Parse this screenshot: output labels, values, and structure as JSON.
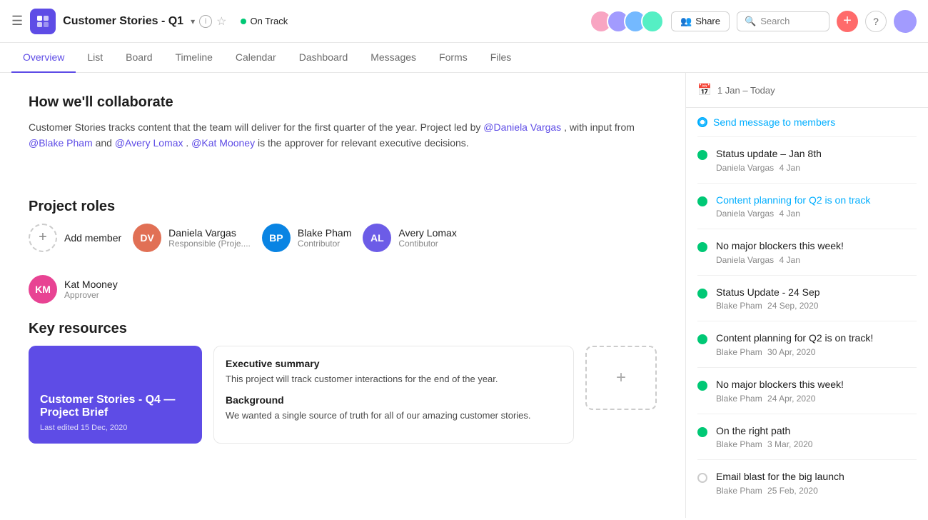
{
  "topbar": {
    "project_title": "Customer Stories - Q1",
    "status_label": "On Track",
    "share_label": "Share",
    "search_placeholder": "Search",
    "add_icon": "+",
    "help_icon": "?"
  },
  "nav": {
    "tabs": [
      "Overview",
      "List",
      "Board",
      "Timeline",
      "Calendar",
      "Dashboard",
      "Messages",
      "Forms",
      "Files"
    ],
    "active": "Overview"
  },
  "overview": {
    "collaborate_title": "How we'll collaborate",
    "collaborate_desc1": "Customer Stories tracks content that the team will deliver for the first quarter of the year. Project led by",
    "mention_daniela": "@Daniela Vargas",
    "collaborate_desc2": ", with input from",
    "mention_blake": "@Blake Pham",
    "collaborate_desc3": "and",
    "mention_avery": "@Avery Lomax",
    "collaborate_desc4": ".",
    "mention_kat": "@Kat Mooney",
    "collaborate_desc5": "is the approver for relevant executive decisions.",
    "roles_title": "Project roles",
    "add_member_label": "Add member",
    "roles": [
      {
        "name": "Daniela Vargas",
        "role": "Responsible (Proje....",
        "initials": "DV",
        "color": "dv"
      },
      {
        "name": "Blake Pham",
        "role": "Contributor",
        "initials": "BP",
        "color": "bp"
      },
      {
        "name": "Avery Lomax",
        "role": "Contibutor",
        "initials": "AL",
        "color": "al"
      },
      {
        "name": "Kat Mooney",
        "role": "Approver",
        "initials": "KM",
        "color": "km"
      }
    ],
    "resources_title": "Key resources",
    "resource_card": {
      "title": "Customer Stories - Q4 — Project Brief",
      "date": "Last edited 15 Dec, 2020"
    },
    "resource_doc": {
      "exec_title": "Executive summary",
      "exec_desc": "This project will track customer interactions for the end of the year.",
      "bg_title": "Background",
      "bg_desc": "We wanted a single source of truth for all of our amazing customer stories."
    }
  },
  "sidebar": {
    "date_range": "1 Jan – Today",
    "send_message": "Send message to members",
    "items": [
      {
        "type": "status",
        "title": "Status update – Jan 8th",
        "author": "Daniela Vargas",
        "date": "4 Jan",
        "dot": "green",
        "link": false
      },
      {
        "type": "status",
        "title": "Content planning for Q2 is on track",
        "author": "Daniela Vargas",
        "date": "4 Jan",
        "dot": "green",
        "link": true
      },
      {
        "type": "status",
        "title": "No major blockers this week!",
        "author": "Daniela Vargas",
        "date": "4 Jan",
        "dot": "green",
        "link": false
      },
      {
        "type": "status",
        "title": "Status Update - 24 Sep",
        "author": "Blake Pham",
        "date": "24 Sep, 2020",
        "dot": "green",
        "link": false
      },
      {
        "type": "status",
        "title": "Content planning for Q2 is on track!",
        "author": "Blake Pham",
        "date": "30 Apr, 2020",
        "dot": "green",
        "link": false
      },
      {
        "type": "status",
        "title": "No major blockers this week!",
        "author": "Blake Pham",
        "date": "24 Apr, 2020",
        "dot": "green",
        "link": false
      },
      {
        "type": "status",
        "title": "On the right path",
        "author": "Blake Pham",
        "date": "3 Mar, 2020",
        "dot": "green",
        "link": false
      },
      {
        "type": "status",
        "title": "Email blast for the big launch",
        "author": "Blake Pham",
        "date": "25 Feb, 2020",
        "dot": "empty",
        "link": false
      }
    ]
  }
}
